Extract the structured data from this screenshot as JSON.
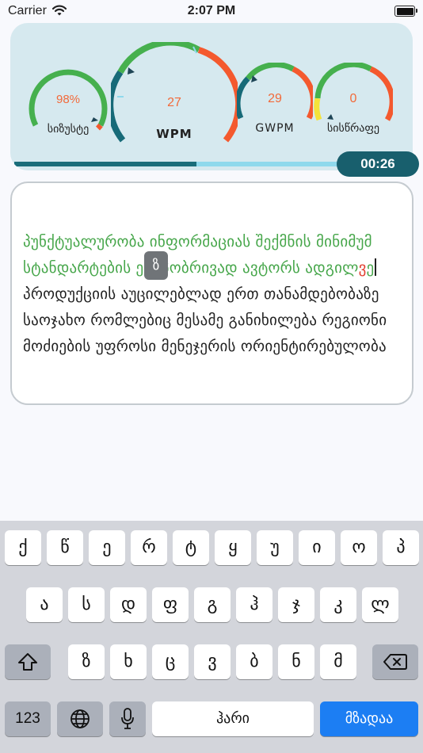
{
  "status_bar": {
    "carrier": "Carrier",
    "time": "2:07 PM"
  },
  "gauges": [
    {
      "id": "accuracy",
      "value": "98%",
      "label": "სიზუსტე",
      "level_pct": 98
    },
    {
      "id": "wpm",
      "value": "27",
      "label": "WPM"
    },
    {
      "id": "gwpm",
      "value": "29",
      "label": "GWPM"
    },
    {
      "id": "speed",
      "value": "0",
      "label": "სისწრაფე"
    }
  ],
  "progress": {
    "fraction": 0.56
  },
  "timer": "00:26",
  "typing": {
    "typed_text": "პუნქტუალურობა ინფორმაციას შექმნის მინიმუმ სტანდარტების ეტაპობრივად ავტორს ადგილ",
    "error_char": "ვ",
    "cursor_char": "ე",
    "remaining_text": "პროდუქციის აუცილებლად ერთ თანამდებობაზე საოჯახო რომლებიც მესამე განიხილება რეგიონი მოძიების უფროსი მენეჯერის ორიენტირებულობა",
    "key_tip": "ზ"
  },
  "colors": {
    "panel_bg": "#d6e9ef",
    "gauge_green": "#46b04e",
    "gauge_orange": "#f4592e",
    "gauge_teal": "#176a78",
    "gauge_yellow": "#f4e33a",
    "typed_green": "#46a64a",
    "error_red": "#e23d2f",
    "timer_bg": "#185f6d",
    "key_blue": "#1c7ef3"
  },
  "keyboard": {
    "row1": [
      "ქ",
      "წ",
      "ე",
      "რ",
      "ტ",
      "ყ",
      "უ",
      "ი",
      "ო",
      "პ"
    ],
    "row2": [
      "ა",
      "ს",
      "დ",
      "ფ",
      "გ",
      "ჰ",
      "ჯ",
      "კ",
      "ლ"
    ],
    "row3": [
      "ზ",
      "ხ",
      "ც",
      "ვ",
      "ბ",
      "ნ",
      "მ"
    ],
    "num_label": "123",
    "space_label": "ჰარი",
    "go_label": "მზადაა",
    "icons": [
      "shift-icon",
      "backspace-icon",
      "globe-icon",
      "mic-icon"
    ]
  }
}
